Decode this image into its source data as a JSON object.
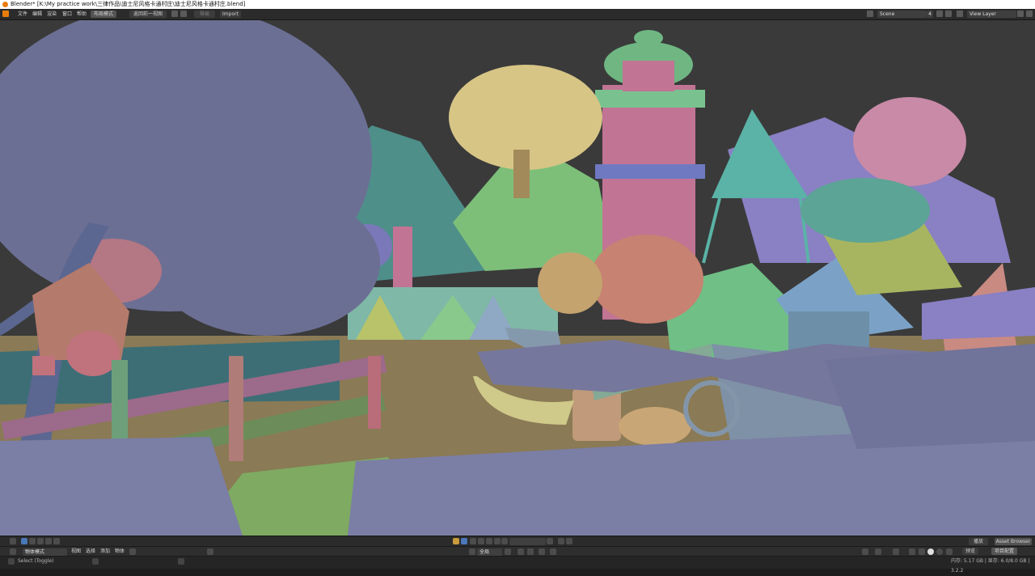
{
  "window": {
    "title": "Blender* [K:\\My practice work\\三律作品\\迪士尼风格卡通村庄\\迪士尼风格卡通村庄.blend]"
  },
  "topbar": {
    "menus": [
      "文件",
      "编辑",
      "渲染",
      "窗口",
      "帮助"
    ],
    "workspace_tab": "布局模式",
    "back_button": "返回前一视图",
    "export_label": "导出",
    "import_label": "Import",
    "scene_name": "Scene",
    "scene_count": "4",
    "view_layer": "View Layer"
  },
  "timeline": {
    "search_placeholder": "",
    "playback_label": "播放",
    "asset_browser": "Asset Browser"
  },
  "editorbar": {
    "mode_select": "物体模式",
    "menus": [
      "视图",
      "选择",
      "添加",
      "物体"
    ],
    "transform_global": "全局",
    "right_tabs": [
      "预览",
      "项目配置"
    ]
  },
  "statusbar": {
    "select_hint": "Select (Toggle)",
    "memory": "内存: 5.17 GB | 显存: 6.0/8.0 GB | 3.2.2"
  }
}
